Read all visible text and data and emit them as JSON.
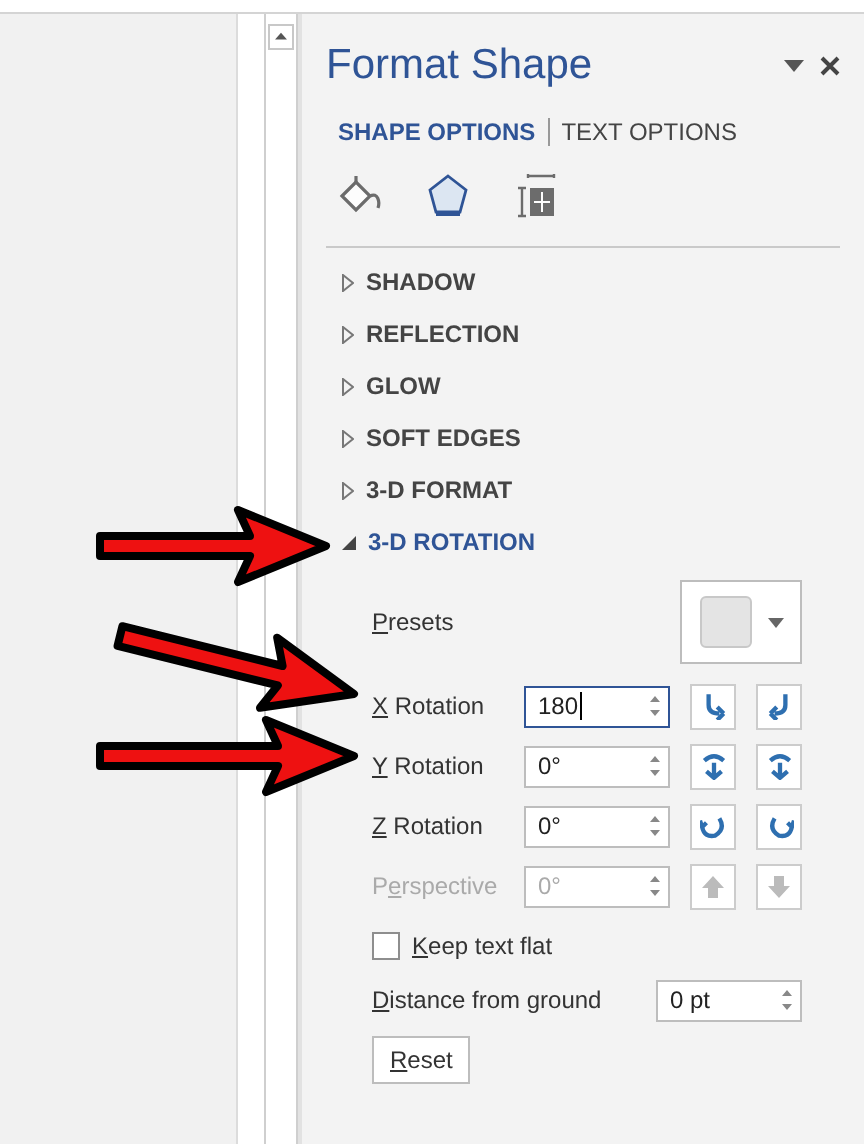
{
  "panel": {
    "title": "Format Shape",
    "tabs": [
      {
        "label": "SHAPE OPTIONS",
        "selected": true
      },
      {
        "label": "TEXT OPTIONS",
        "selected": false
      }
    ],
    "icon_tabs": [
      {
        "kind": "fill",
        "selected": false
      },
      {
        "kind": "effects",
        "selected": true
      },
      {
        "kind": "layout",
        "selected": false
      }
    ],
    "sections": [
      {
        "label": "SHADOW",
        "expanded": false
      },
      {
        "label": "REFLECTION",
        "expanded": false
      },
      {
        "label": "GLOW",
        "expanded": false
      },
      {
        "label": "SOFT EDGES",
        "expanded": false
      },
      {
        "label": "3-D FORMAT",
        "expanded": false
      },
      {
        "label": "3-D ROTATION",
        "expanded": true
      }
    ],
    "presets": {
      "label_parts": {
        "key": "P",
        "rest": "resets"
      }
    },
    "rotations": [
      {
        "label_parts": {
          "key": "X",
          "rest": " Rotation"
        },
        "value": "180",
        "focused": true,
        "disabled": false
      },
      {
        "label_parts": {
          "key": "Y",
          "rest": " Rotation"
        },
        "value": "0°",
        "focused": false,
        "disabled": false
      },
      {
        "label_parts": {
          "key": "Z",
          "rest": " Rotation"
        },
        "value": "0°",
        "focused": false,
        "disabled": false
      },
      {
        "label_parts": {
          "lead": "P",
          "key": "e",
          "rest": "rspective"
        },
        "value": "0°",
        "focused": false,
        "disabled": true
      }
    ],
    "keep_text_flat": {
      "label_parts": {
        "key": "K",
        "rest": "eep text flat"
      },
      "checked": false
    },
    "distance": {
      "label_parts": {
        "key": "D",
        "rest": "istance from ground"
      },
      "value": "0 pt"
    },
    "reset": {
      "label_parts": {
        "key": "R",
        "rest": "eset"
      }
    }
  }
}
